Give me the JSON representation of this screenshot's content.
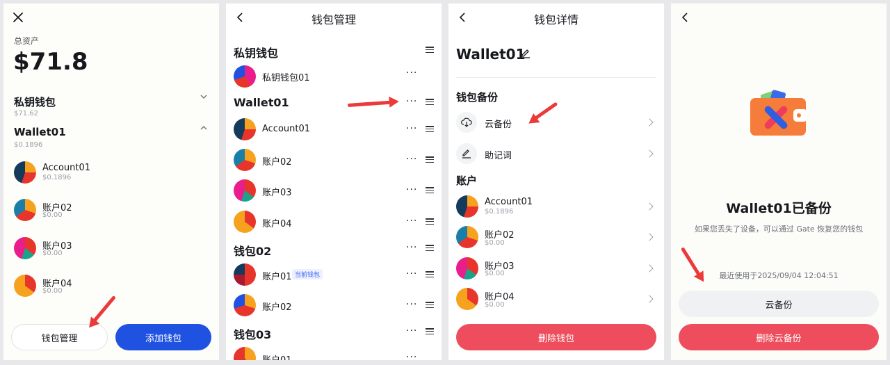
{
  "panel1": {
    "total_label": "总资产",
    "total_value": "$71.8",
    "wallets": [
      {
        "name": "私钥钱包",
        "value": "$71.62"
      },
      {
        "name": "Wallet01",
        "value": "$0.1896"
      }
    ],
    "accounts": [
      {
        "name": "Account01",
        "value": "$0.1896"
      },
      {
        "name": "账户02",
        "value": "$0.00"
      },
      {
        "name": "账户03",
        "value": "$0.00"
      },
      {
        "name": "账户04",
        "value": "$0.00"
      }
    ],
    "manage_label": "钱包管理",
    "add_label": "添加钱包"
  },
  "panel2": {
    "title": "钱包管理",
    "groups": [
      {
        "name": "私钥钱包",
        "items": [
          {
            "name": "私钥钱包01"
          }
        ]
      },
      {
        "name": "Wallet01",
        "items": [
          {
            "name": "Account01"
          },
          {
            "name": "账户02"
          },
          {
            "name": "账户03"
          },
          {
            "name": "账户04"
          }
        ]
      },
      {
        "name": "钱包02",
        "items": [
          {
            "name": "账户01",
            "badge": "当前钱包"
          },
          {
            "name": "账户02"
          }
        ]
      },
      {
        "name": "钱包03",
        "items": [
          {
            "name": "账户01"
          }
        ]
      }
    ]
  },
  "panel3": {
    "title": "钱包详情",
    "wallet_name": "Wallet01",
    "backup_header": "钱包备份",
    "backup_options": [
      {
        "label": "云备份",
        "icon": "cloud-download-icon"
      },
      {
        "label": "助记词",
        "icon": "pencil-icon"
      }
    ],
    "accounts_header": "账户",
    "accounts": [
      {
        "name": "Account01",
        "value": "$0.1896"
      },
      {
        "name": "账户02",
        "value": "$0.00"
      },
      {
        "name": "账户03",
        "value": "$0.00"
      },
      {
        "name": "账户04",
        "value": "$0.00"
      }
    ],
    "delete_label": "删除钱包"
  },
  "panel4": {
    "headline": "Wallet01已备份",
    "description": "如果您丢失了设备，可以通过 Gate 恢复您的钱包",
    "last_used": "最近使用于2025/09/04 12:04:51",
    "cloud_backup_label": "云备份",
    "delete_backup_label": "删除云备份"
  },
  "colors": {
    "primary_blue": "#1f52e0",
    "danger_red": "#ee4d5d",
    "arrow_red": "#ea3a3a",
    "badge_blue": "#3d64f0"
  }
}
